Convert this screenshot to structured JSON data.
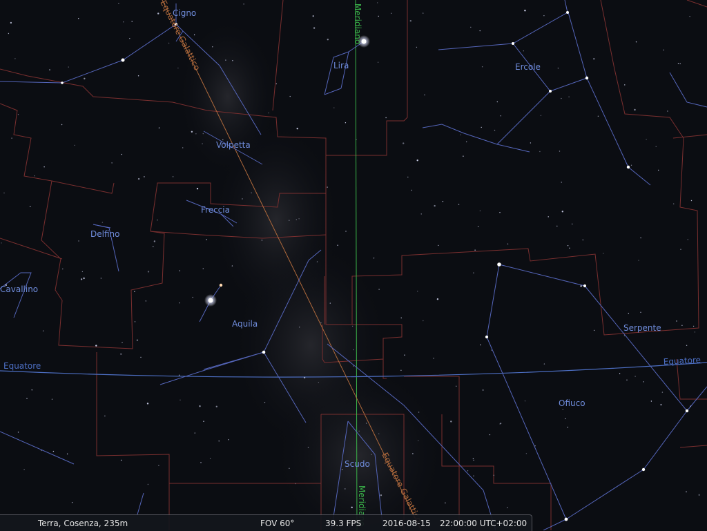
{
  "constellations": {
    "cigno": "Cigno",
    "lira": "Lira",
    "ercole": "Ercole",
    "volpetta": "Volpetta",
    "freccia": "Freccia",
    "delfino": "Delfino",
    "cavallino": "Cavallino",
    "aquila": "Aquila",
    "serpente": "Serpente",
    "ofiuco": "Ofiuco",
    "scudo": "Scudo"
  },
  "lines": {
    "meridian_top": "Meridiano",
    "meridian_bottom": "Meridiano",
    "equator_left": "Equatore",
    "equator_right": "Equatore",
    "galactic_top": "Equatore Galattico",
    "galactic_bottom": "Equatore Galattico"
  },
  "statusbar": {
    "location": "Terra, Cosenza, 235m",
    "fov": "FOV 60°",
    "fps": "39.3 FPS",
    "date": "2016-08-15",
    "time": "22:00:00 UTC+02:00"
  },
  "colors": {
    "sky": "#0b0d12",
    "constellation_line": "#5566bb",
    "constellation_label": "#6f8cdb",
    "boundary": "#7a2f2f",
    "meridian": "#3bb54a",
    "equator": "#4d6fc4",
    "galactic": "#b06a3c"
  }
}
